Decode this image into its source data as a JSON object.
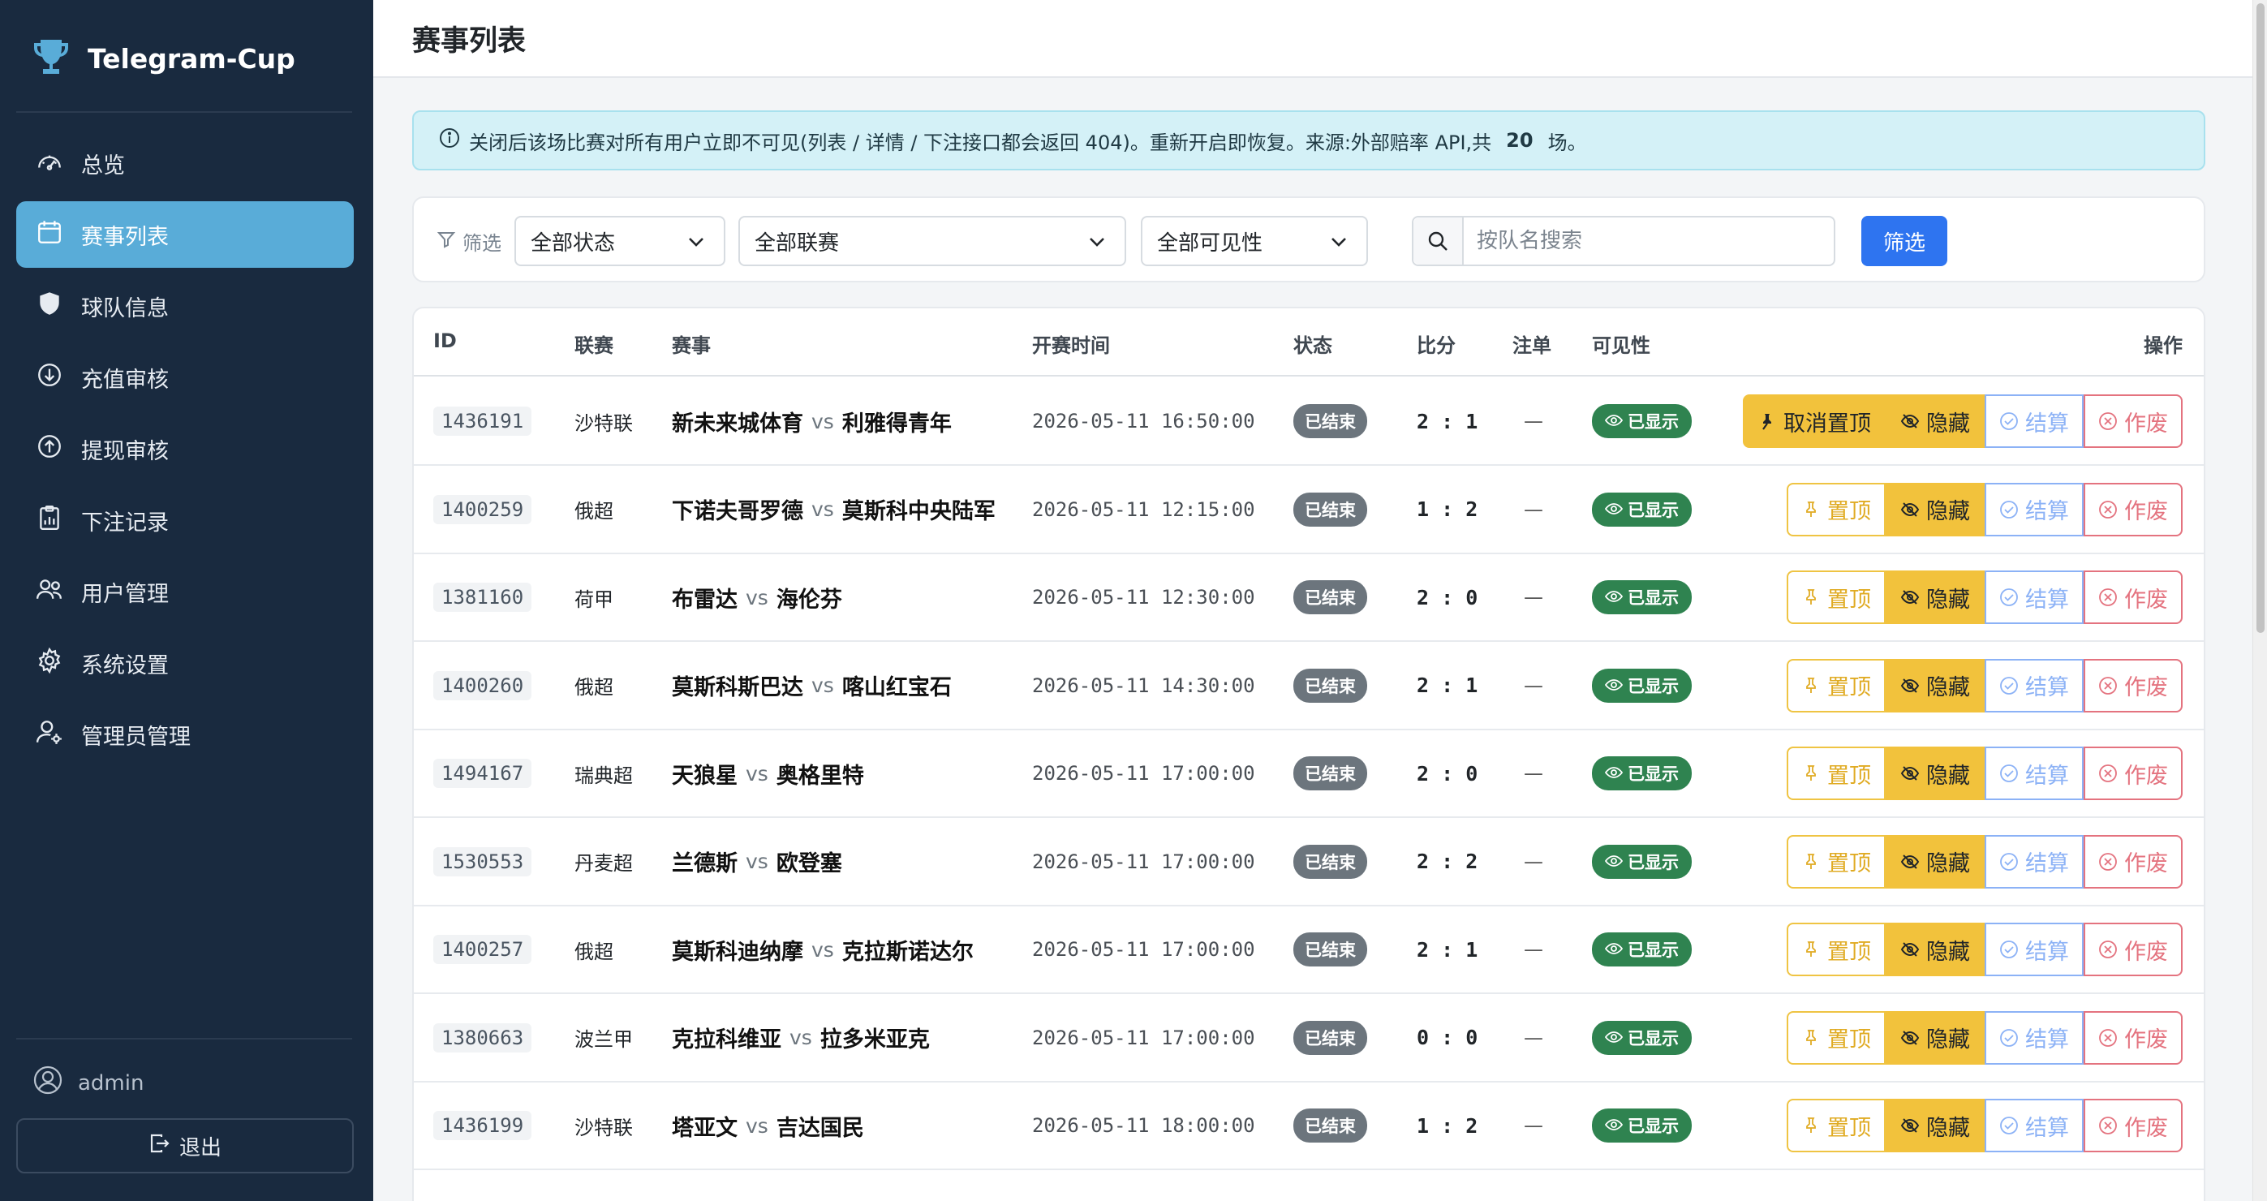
{
  "app": {
    "brand": "Telegram-Cup"
  },
  "sidebar": {
    "items": [
      {
        "label": "总览",
        "icon": "gauge-icon",
        "active": false
      },
      {
        "label": "赛事列表",
        "icon": "calendar-icon",
        "active": true
      },
      {
        "label": "球队信息",
        "icon": "shield-icon",
        "active": false
      },
      {
        "label": "充值审核",
        "icon": "arrow-down-circle-icon",
        "active": false
      },
      {
        "label": "提现审核",
        "icon": "arrow-up-circle-icon",
        "active": false
      },
      {
        "label": "下注记录",
        "icon": "clipboard-data-icon",
        "active": false
      },
      {
        "label": "用户管理",
        "icon": "people-icon",
        "active": false
      },
      {
        "label": "系统设置",
        "icon": "gear-icon",
        "active": false
      },
      {
        "label": "管理员管理",
        "icon": "person-gear-icon",
        "active": false
      }
    ],
    "user": "admin",
    "logout_label": "退出"
  },
  "header": {
    "title": "赛事列表"
  },
  "alert": {
    "text_before": "关闭后该场比赛对所有用户立即不可见(列表 / 详情 / 下注接口都会返回 404)。重新开启即恢复。来源:外部赔率 API,共",
    "count": "20",
    "text_after": "场。"
  },
  "filters": {
    "label": "筛选",
    "status_value": "全部状态",
    "league_value": "全部联赛",
    "visibility_value": "全部可见性",
    "search_placeholder": "按队名搜索",
    "button_label": "筛选"
  },
  "table": {
    "columns": {
      "id": "ID",
      "league": "联赛",
      "match": "赛事",
      "time": "开赛时间",
      "status": "状态",
      "score": "比分",
      "bets": "注单",
      "visibility": "可见性",
      "actions": "操作"
    },
    "vs_label": "vs",
    "labels": {
      "pin": "置顶",
      "unpin": "取消置顶",
      "hide": "隐藏",
      "settle": "结算",
      "void": "作废"
    },
    "rows": [
      {
        "id": "1436191",
        "league": "沙特联",
        "home": "新未来城体育",
        "away": "利雅得青年",
        "time": "2026-05-11 16:50:00",
        "status": "已结束",
        "score": "2 : 1",
        "bets": "—",
        "visibility": "已显示",
        "pinned": true
      },
      {
        "id": "1400259",
        "league": "俄超",
        "home": "下诺夫哥罗德",
        "away": "莫斯科中央陆军",
        "time": "2026-05-11 12:15:00",
        "status": "已结束",
        "score": "1 : 2",
        "bets": "—",
        "visibility": "已显示",
        "pinned": false
      },
      {
        "id": "1381160",
        "league": "荷甲",
        "home": "布雷达",
        "away": "海伦芬",
        "time": "2026-05-11 12:30:00",
        "status": "已结束",
        "score": "2 : 0",
        "bets": "—",
        "visibility": "已显示",
        "pinned": false
      },
      {
        "id": "1400260",
        "league": "俄超",
        "home": "莫斯科斯巴达",
        "away": "喀山红宝石",
        "time": "2026-05-11 14:30:00",
        "status": "已结束",
        "score": "2 : 1",
        "bets": "—",
        "visibility": "已显示",
        "pinned": false
      },
      {
        "id": "1494167",
        "league": "瑞典超",
        "home": "天狼星",
        "away": "奥格里特",
        "time": "2026-05-11 17:00:00",
        "status": "已结束",
        "score": "2 : 0",
        "bets": "—",
        "visibility": "已显示",
        "pinned": false
      },
      {
        "id": "1530553",
        "league": "丹麦超",
        "home": "兰德斯",
        "away": "欧登塞",
        "time": "2026-05-11 17:00:00",
        "status": "已结束",
        "score": "2 : 2",
        "bets": "—",
        "visibility": "已显示",
        "pinned": false
      },
      {
        "id": "1400257",
        "league": "俄超",
        "home": "莫斯科迪纳摩",
        "away": "克拉斯诺达尔",
        "time": "2026-05-11 17:00:00",
        "status": "已结束",
        "score": "2 : 1",
        "bets": "—",
        "visibility": "已显示",
        "pinned": false
      },
      {
        "id": "1380663",
        "league": "波兰甲",
        "home": "克拉科维亚",
        "away": "拉多米亚克",
        "time": "2026-05-11 17:00:00",
        "status": "已结束",
        "score": "0 : 0",
        "bets": "—",
        "visibility": "已显示",
        "pinned": false
      },
      {
        "id": "1436199",
        "league": "沙特联",
        "home": "塔亚文",
        "away": "吉达国民",
        "time": "2026-05-11 18:00:00",
        "status": "已结束",
        "score": "1 : 2",
        "bets": "—",
        "visibility": "已显示",
        "pinned": false
      }
    ]
  },
  "colors": {
    "sidebar_bg": "#192a3f",
    "active_nav": "#59acd8",
    "primary": "#2e74f0",
    "warning": "#f2c23c",
    "success": "#2f8350",
    "danger": "#d9384a"
  }
}
